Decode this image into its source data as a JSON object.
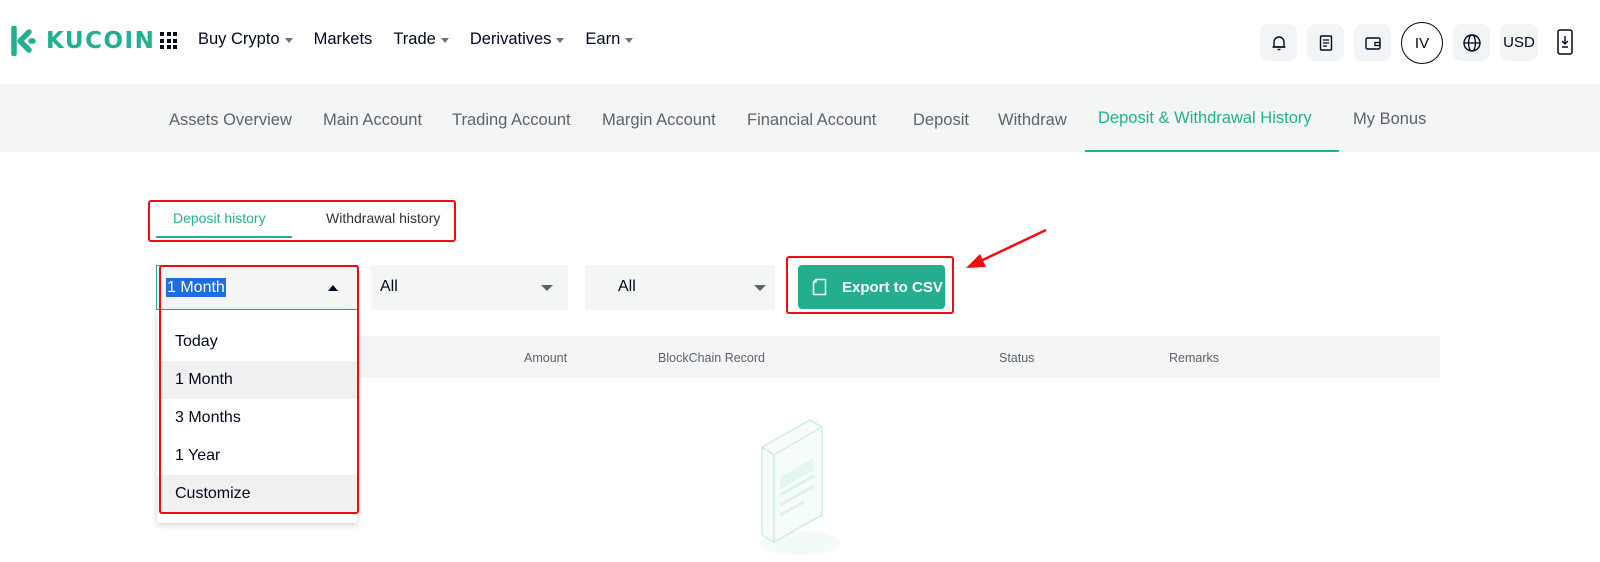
{
  "brand": {
    "name": "KUCOIN",
    "accent": "#23af91",
    "highlight_red": "#f10d0d"
  },
  "topnav": {
    "items": [
      {
        "label": "Buy Crypto",
        "dropdown": true
      },
      {
        "label": "Markets",
        "dropdown": false
      },
      {
        "label": "Trade",
        "dropdown": true
      },
      {
        "label": "Derivatives",
        "dropdown": true
      },
      {
        "label": "Earn",
        "dropdown": true
      }
    ],
    "avatar_initials": "IV",
    "currency": "USD",
    "icons": [
      "apps-grid-icon",
      "bell-icon",
      "orders-icon",
      "wallet-icon",
      "globe-icon",
      "download-app-icon"
    ]
  },
  "subnav": {
    "items": [
      "Assets Overview",
      "Main Account",
      "Trading Account",
      "Margin Account",
      "Financial Account",
      "Deposit",
      "Withdraw",
      "Deposit & Withdrawal History",
      "My Bonus"
    ],
    "active": "Deposit & Withdrawal History"
  },
  "history_tabs": {
    "deposit": "Deposit history",
    "withdrawal": "Withdrawal history",
    "active": "Deposit history"
  },
  "filters": {
    "period": {
      "value": "1 Month",
      "options": [
        "Today",
        "1 Month",
        "3 Months",
        "1 Year",
        "Customize"
      ]
    },
    "coin": {
      "value": "All"
    },
    "status": {
      "value": "All"
    }
  },
  "export_button": {
    "label": "Export to CSV"
  },
  "table": {
    "columns": [
      "Amount",
      "BlockChain Record",
      "Status",
      "Remarks"
    ],
    "rows": []
  }
}
